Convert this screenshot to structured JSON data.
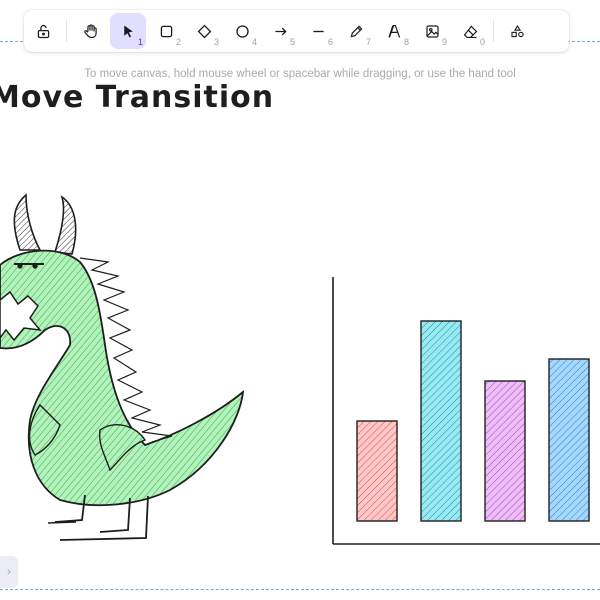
{
  "toolbar": {
    "tools": [
      {
        "id": "lock",
        "icon": "lock-open-icon",
        "key": ""
      },
      {
        "id": "hand",
        "icon": "hand-icon",
        "key": ""
      },
      {
        "id": "selection",
        "icon": "cursor-arrow-icon",
        "key": "1",
        "active": true
      },
      {
        "id": "rectangle",
        "icon": "square-icon",
        "key": "2"
      },
      {
        "id": "diamond",
        "icon": "diamond-icon",
        "key": "3"
      },
      {
        "id": "ellipse",
        "icon": "circle-icon",
        "key": "4"
      },
      {
        "id": "arrow",
        "icon": "arrow-right-icon",
        "key": "5"
      },
      {
        "id": "line",
        "icon": "line-icon",
        "key": "6"
      },
      {
        "id": "draw",
        "icon": "pencil-icon",
        "key": "7"
      },
      {
        "id": "text",
        "icon": "text-a-icon",
        "key": "8"
      },
      {
        "id": "image",
        "icon": "image-icon",
        "key": "9"
      },
      {
        "id": "eraser",
        "icon": "eraser-icon",
        "key": "0"
      },
      {
        "id": "library",
        "icon": "shapes-library-icon",
        "key": ""
      }
    ],
    "active_color": "#e0dfff"
  },
  "canvas": {
    "hint": "To move canvas, hold mouse wheel or spacebar while dragging, or use the hand tool",
    "title": "Move Transition"
  },
  "chart_data": {
    "type": "bar",
    "categories": [
      "",
      "",
      "",
      ""
    ],
    "values": [
      100,
      200,
      140,
      162
    ],
    "ylim": [
      0,
      224
    ],
    "colors": [
      "#e03131",
      "#0c8599",
      "#9c36b5",
      "#1971c2"
    ],
    "fills": [
      "#ffc9c9",
      "#99e9f2",
      "#eebefa",
      "#a5d8ff"
    ],
    "grid": false
  },
  "colors": {
    "frame_dash": "#7aa5d8",
    "dragon_fill": "#b2f2bb",
    "dragon_hatch": "#2f9e44"
  }
}
